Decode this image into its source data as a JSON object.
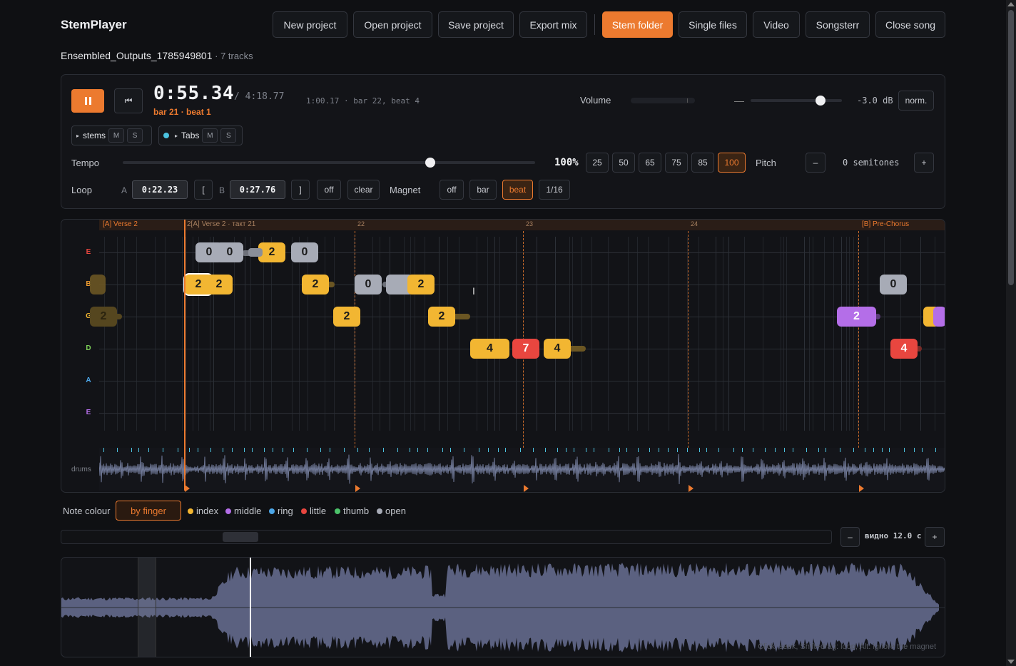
{
  "app": {
    "brand": "StemPlayer"
  },
  "toolbar": {
    "new_project": "New project",
    "open_project": "Open project",
    "save_project": "Save project",
    "export_mix": "Export mix",
    "stem_folder": "Stem folder",
    "single_files": "Single files",
    "video": "Video",
    "songsterr": "Songsterr",
    "close_song": "Close song"
  },
  "song": {
    "name": "Ensembled_Outputs_1785949801",
    "tracks": " · 7 tracks"
  },
  "transport": {
    "current_time": "0:55.34",
    "total_time": "/ 4:18.77",
    "bar_beat": "bar 21 · beat 1",
    "loop_info": "1:00.17 · bar 22, beat 4",
    "volume_label": "Volume",
    "volume_dash": "—",
    "volume_db": "-3.0 dB",
    "normalize": "norm."
  },
  "tracks": {
    "stems": {
      "label": "stems",
      "m": "M",
      "s": "S"
    },
    "tabs": {
      "label": "Tabs",
      "m": "M",
      "s": "S",
      "color": "#4cc3e0"
    }
  },
  "tempo": {
    "label": "Tempo",
    "value": "100%",
    "presets": [
      "25",
      "50",
      "65",
      "75",
      "85",
      "100"
    ],
    "active_preset": "100",
    "pitch_label": "Pitch",
    "minus": "–",
    "plus": "+",
    "semitones": "0 semitones"
  },
  "loop": {
    "label": "Loop",
    "a_label": "A",
    "a_value": "0:22.23",
    "a_btn": "[",
    "b_label": "B",
    "b_value": "0:27.76",
    "b_btn": "]",
    "off": "off",
    "clear": "clear",
    "magnet_label": "Magnet",
    "magnet_off": "off",
    "magnet_bar": "bar",
    "magnet_beat": "beat",
    "magnet_16": "1/16",
    "magnet_active": "beat"
  },
  "tab": {
    "sections": [
      "[A] Verse 2",
      "2[A] Verse 2 · такт 21",
      "[B] Pre-Chorus"
    ],
    "bars": [
      "22",
      "23",
      "24",
      "-"
    ],
    "strings": [
      {
        "name": "E",
        "color": "#e8463f"
      },
      {
        "name": "B",
        "color": "#ec9a2f"
      },
      {
        "name": "G",
        "color": "#f2b632"
      },
      {
        "name": "D",
        "color": "#7fd25a"
      },
      {
        "name": "A",
        "color": "#4ca6e8"
      },
      {
        "name": "E",
        "color": "#b46ee8"
      }
    ],
    "drums_label": "drums",
    "notes": [
      {
        "fret": "0",
        "finger": "open",
        "string": 0
      },
      {
        "fret": "0",
        "finger": "open",
        "string": 0
      },
      {
        "fret": "2",
        "finger": "index",
        "string": 0
      },
      {
        "fret": "0",
        "finger": "open",
        "string": 0
      },
      {
        "fret": "2",
        "finger": "index",
        "string": 1
      },
      {
        "fret": "2",
        "finger": "index",
        "string": 1
      },
      {
        "fret": "2",
        "finger": "index",
        "string": 1
      },
      {
        "fret": "0",
        "finger": "open",
        "string": 1
      },
      {
        "fret": "2",
        "finger": "index",
        "string": 1
      },
      {
        "fret": "0",
        "finger": "open",
        "string": 1
      },
      {
        "fret": "2",
        "finger": "index",
        "string": 2
      },
      {
        "fret": "2",
        "finger": "index",
        "string": 2
      },
      {
        "fret": "2",
        "finger": "middle",
        "string": 2
      },
      {
        "fret": "4",
        "finger": "index",
        "string": 3
      },
      {
        "fret": "7",
        "finger": "little",
        "string": 3
      },
      {
        "fret": "4",
        "finger": "index",
        "string": 3
      },
      {
        "fret": "4",
        "finger": "little",
        "string": 3
      },
      {
        "fret": "2",
        "finger": "index",
        "string": 2
      }
    ]
  },
  "legend": {
    "label": "Note colour",
    "mode": "by finger",
    "items": [
      {
        "name": "index",
        "color": "#f2b632"
      },
      {
        "name": "middle",
        "color": "#b46ee8"
      },
      {
        "name": "ring",
        "color": "#4ca6e8"
      },
      {
        "name": "little",
        "color": "#e8463f"
      },
      {
        "name": "thumb",
        "color": "#4cc36a"
      },
      {
        "name": "open",
        "color": "#a7abb6"
      }
    ]
  },
  "zoom": {
    "minus": "–",
    "plus": "+",
    "visible": "видно 12.0 с"
  },
  "overview": {
    "hint": "Click: seek, Shift+drag: loop, Alt: ignore the magnet"
  },
  "colors": {
    "accent": "#ec7a2f"
  }
}
